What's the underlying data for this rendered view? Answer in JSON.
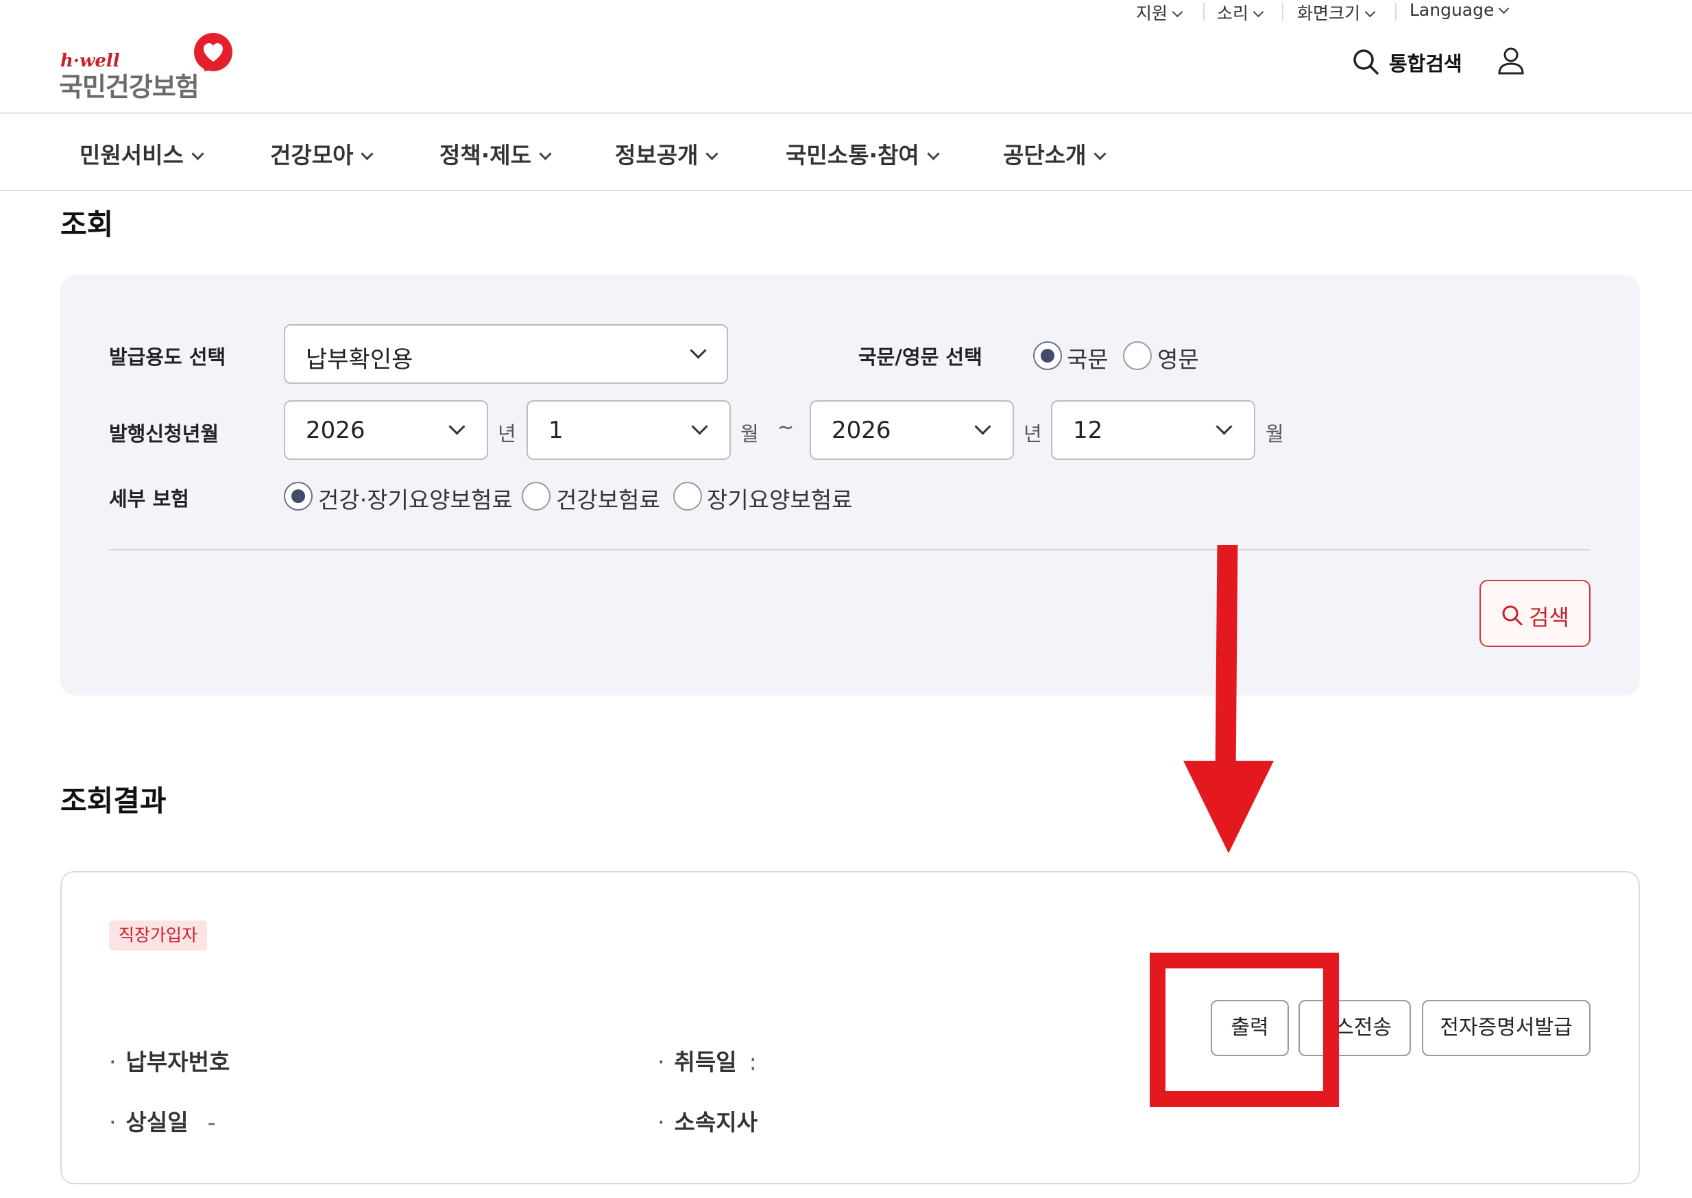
{
  "header": {
    "utility_menu": [
      {
        "label": "지원"
      },
      {
        "label": "소리"
      },
      {
        "label": "화면크기"
      },
      {
        "label": "Language"
      }
    ],
    "logo": {
      "brand": "h·well",
      "name": "국민건강보험",
      "icon": "heart-logo-icon"
    },
    "search_label": "통합검색",
    "icons": {
      "search": "search-icon",
      "user": "user-icon"
    }
  },
  "gnb": [
    {
      "label": "민원서비스"
    },
    {
      "label": "건강모아"
    },
    {
      "label": "정책·제도"
    },
    {
      "label": "정보공개"
    },
    {
      "label": "국민소통·참여"
    },
    {
      "label": "공단소개"
    }
  ],
  "query": {
    "title": "조회",
    "purpose": {
      "label": "발급용도 선택",
      "value": "납부확인용"
    },
    "language": {
      "label": "국문/영문 선택",
      "options": [
        {
          "label": "국문",
          "selected": true
        },
        {
          "label": "영문",
          "selected": false
        }
      ]
    },
    "period": {
      "label": "발행신청년월",
      "from_year": "2026",
      "from_month": "1",
      "to_year": "2026",
      "to_month": "12",
      "year_unit": "년",
      "month_unit": "월",
      "tilde": "~"
    },
    "insurance": {
      "label": "세부 보험",
      "options": [
        {
          "label": "건강·장기요양보험료",
          "selected": true
        },
        {
          "label": "건강보험료",
          "selected": false
        },
        {
          "label": "장기요양보험료",
          "selected": false
        }
      ]
    },
    "search_button": "검색"
  },
  "results": {
    "title": "조회결과",
    "badge": "직장가입자",
    "fields": {
      "payer_no": {
        "label": "납부자번호",
        "value": ""
      },
      "acquired": {
        "label": "취득일",
        "value": ":"
      },
      "lost": {
        "label": "상실일",
        "value": "-"
      },
      "branch": {
        "label": "소속지사",
        "value": ""
      }
    },
    "dot": "·",
    "buttons": {
      "print": "출력",
      "fax": "팩스전송",
      "fax_visible": "스전송",
      "ecert": "전자증명서발급"
    }
  },
  "annotation": {
    "color": "#e3191f"
  },
  "colors": {
    "accent": "#c8202a",
    "panel_bg": "#f3f4f9",
    "radio_fill": "#434b6b"
  }
}
